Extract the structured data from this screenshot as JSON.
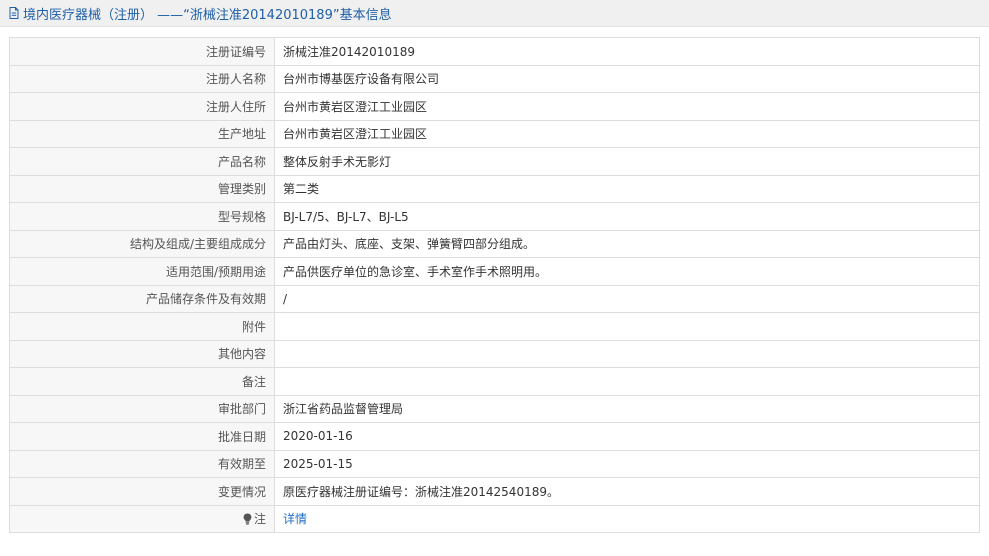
{
  "header": {
    "title": "境内医疗器械（注册） ——“浙械注准20142010189”基本信息"
  },
  "rows": [
    {
      "label": "注册证编号",
      "value": "浙械注准20142010189"
    },
    {
      "label": "注册人名称",
      "value": "台州市博基医疗设备有限公司"
    },
    {
      "label": "注册人住所",
      "value": "台州市黄岩区澄江工业园区"
    },
    {
      "label": "生产地址",
      "value": "台州市黄岩区澄江工业园区"
    },
    {
      "label": "产品名称",
      "value": "整体反射手术无影灯"
    },
    {
      "label": "管理类别",
      "value": "第二类"
    },
    {
      "label": "型号规格",
      "value": "BJ-L7/5、BJ-L7、BJ-L5"
    },
    {
      "label": "结构及组成/主要组成成分",
      "value": "产品由灯头、底座、支架、弹簧臂四部分组成。"
    },
    {
      "label": "适用范围/预期用途",
      "value": "产品供医疗单位的急诊室、手术室作手术照明用。"
    },
    {
      "label": "产品储存条件及有效期",
      "value": "/"
    },
    {
      "label": "附件",
      "value": ""
    },
    {
      "label": "其他内容",
      "value": ""
    },
    {
      "label": "备注",
      "value": ""
    },
    {
      "label": "审批部门",
      "value": "浙江省药品监督管理局"
    },
    {
      "label": "批准日期",
      "value": "2020-01-16"
    },
    {
      "label": "有效期至",
      "value": "2025-01-15"
    },
    {
      "label": "变更情况",
      "value": "原医疗器械注册证编号：浙械注准20142540189。"
    }
  ],
  "note": {
    "label": "注",
    "link": "详情",
    "icon": "bulb-icon"
  },
  "colors": {
    "header_text": "#1f5fa8",
    "link": "#1f6fc5",
    "label_bg": "#f7f7f7",
    "border": "#dddddd"
  }
}
